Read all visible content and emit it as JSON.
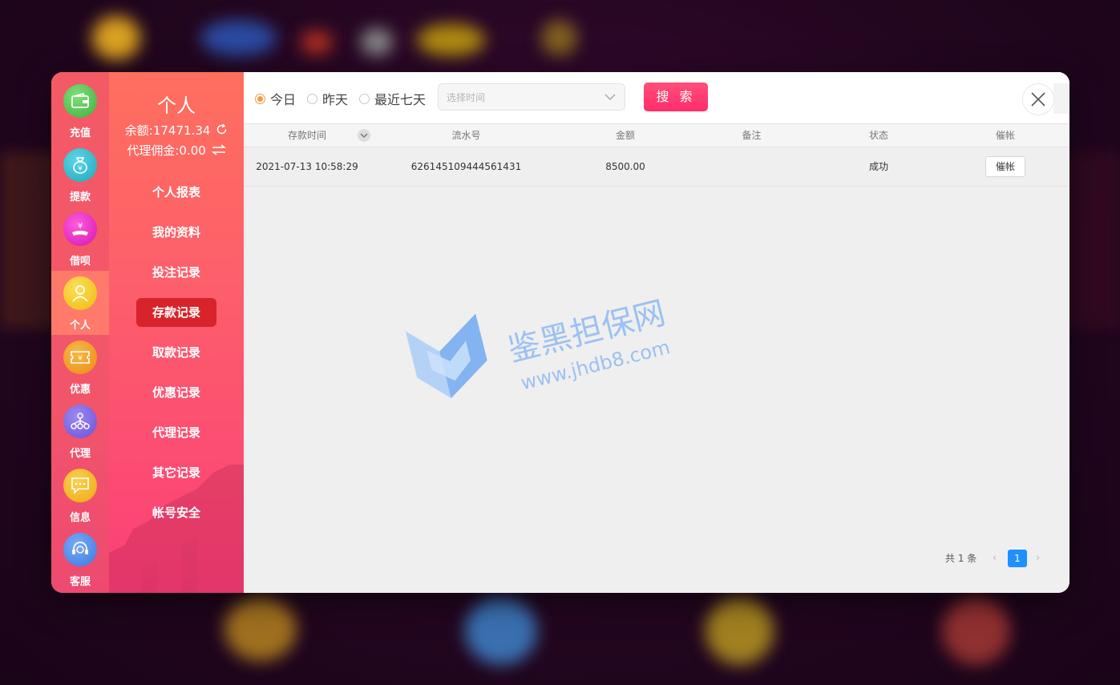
{
  "sidebar": {
    "items": [
      {
        "label": "充值",
        "icon": "wallet-icon",
        "color": "#4fc04a"
      },
      {
        "label": "提款",
        "icon": "money-bag-icon",
        "color": "#27b7c9"
      },
      {
        "label": "借呗",
        "icon": "loan-hand-icon",
        "color": "#e524c0"
      },
      {
        "label": "个人",
        "icon": "user-icon",
        "color": "#f5c51a",
        "active": true
      },
      {
        "label": "优惠",
        "icon": "ticket-icon",
        "color": "#f39a1d"
      },
      {
        "label": "代理",
        "icon": "network-icon",
        "color": "#7b64e6"
      },
      {
        "label": "信息",
        "icon": "message-icon",
        "color": "#f5b21c"
      },
      {
        "label": "客服",
        "icon": "headset-icon",
        "color": "#4a8be8"
      }
    ]
  },
  "panel": {
    "title": "个人",
    "balance": "余额:17471.34",
    "commission": "代理佣金:0.00",
    "menu": [
      {
        "label": "个人报表"
      },
      {
        "label": "我的资料"
      },
      {
        "label": "投注记录"
      },
      {
        "label": "存款记录",
        "active": true
      },
      {
        "label": "取款记录"
      },
      {
        "label": "优惠记录"
      },
      {
        "label": "代理记录"
      },
      {
        "label": "其它记录"
      },
      {
        "label": "帐号安全"
      }
    ]
  },
  "filters": {
    "today": "今日",
    "yesterday": "昨天",
    "last7": "最近七天",
    "date_placeholder": "选择时间",
    "search_label": "搜 索",
    "selected": "today"
  },
  "table": {
    "headers": [
      "存款时间",
      "流水号",
      "金额",
      "备注",
      "状态",
      "催帐"
    ],
    "rows": [
      {
        "time": "2021-07-13 10:58:29",
        "serial": "626145109444561431",
        "amount": "8500.00",
        "note": "",
        "status": "成功",
        "action": "催帐"
      }
    ]
  },
  "watermark": {
    "title": "鉴黑担保网",
    "url": "www.jhdb8.com"
  },
  "pagination": {
    "total": "共 1 条",
    "current": "1"
  },
  "colors": {
    "accent": "#ff2d6b",
    "menu_active": "#d8232a",
    "page_active": "#1e90ff"
  }
}
